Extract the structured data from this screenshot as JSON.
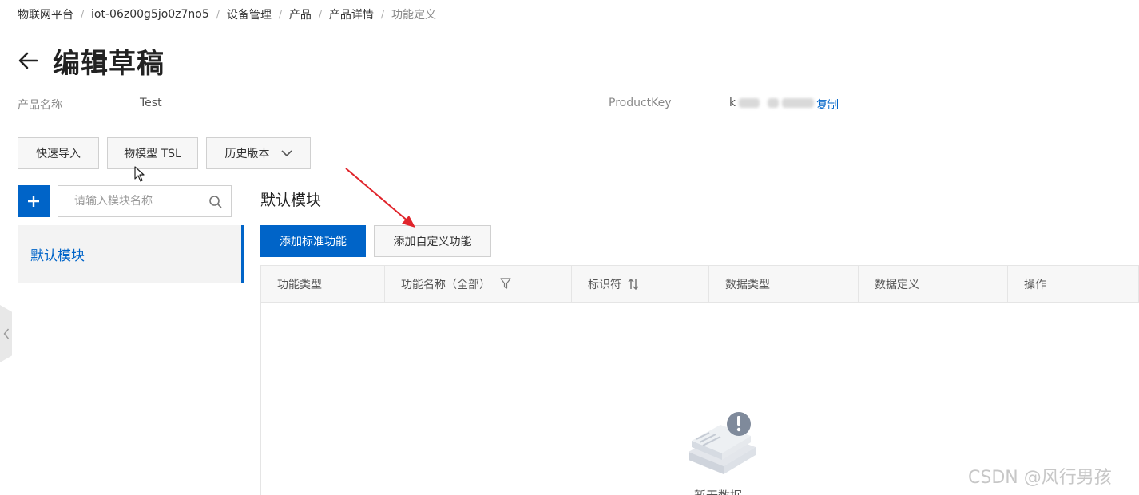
{
  "breadcrumb": {
    "items": [
      "物联网平台",
      "iot-06z00g5jo0z7no5",
      "设备管理",
      "产品",
      "产品详情",
      "功能定义"
    ]
  },
  "header": {
    "title": "编辑草稿"
  },
  "info": {
    "product_name_label": "产品名称",
    "product_name_value": "Test",
    "product_key_label": "ProductKey",
    "product_key_prefix": "k",
    "copy_label": "复制"
  },
  "toolbar": {
    "quick_import": "快速导入",
    "tsl": "物模型 TSL",
    "history": "历史版本"
  },
  "sidebar": {
    "search_placeholder": "请输入模块名称",
    "modules": [
      "默认模块"
    ]
  },
  "main": {
    "section_title": "默认模块",
    "add_standard": "添加标准功能",
    "add_custom": "添加自定义功能",
    "columns": [
      "功能类型",
      "功能名称（全部）",
      "标识符",
      "数据类型",
      "数据定义",
      "操作"
    ],
    "empty_text": "暂无数据"
  },
  "watermark": "CSDN @风行男孩",
  "colors": {
    "accent": "#0064c8",
    "annotation_arrow": "#e0242b"
  },
  "icons": [
    "back-arrow-icon",
    "chevron-down-icon",
    "plus-icon",
    "search-icon",
    "filter-icon",
    "sort-icon",
    "chevron-left-icon",
    "empty-data-icon",
    "mouse-cursor-icon"
  ]
}
